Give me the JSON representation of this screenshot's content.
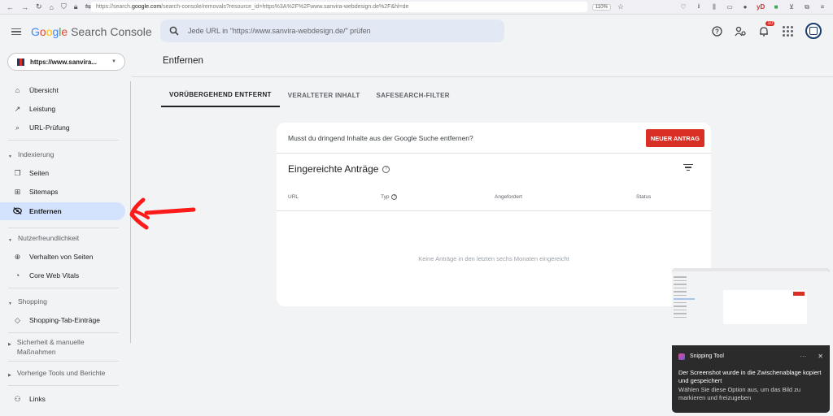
{
  "browser": {
    "url_prefix": "https://search.",
    "url_domain": "google.com",
    "url_rest": "/search-console/removals?resource_id=https%3A%2F%2Fwww.sanvira-webdesign.de%2F&hl=de",
    "zoom": "110%",
    "ext_badge": "yD"
  },
  "header": {
    "logo_letters": [
      "G",
      "o",
      "o",
      "g",
      "l",
      "e"
    ],
    "product": " Search Console",
    "search_placeholder": "Jede URL in \"https://www.sanvira-webdesign.de/\" prüfen",
    "notification_count": "10"
  },
  "colors": {
    "accent": "#d93025",
    "active_nav": "#d3e3fd",
    "brand_blue": "#4285f4"
  },
  "sidebar": {
    "property": "https://www.sanvira...",
    "items": {
      "overview": "Übersicht",
      "performance": "Leistung",
      "url_inspection": "URL-Prüfung",
      "indexing_section": "Indexierung",
      "pages": "Seiten",
      "sitemaps": "Sitemaps",
      "removals": "Entfernen",
      "experience_section": "Nutzerfreundlichkeit",
      "page_experience": "Verhalten von Seiten",
      "core_web_vitals": "Core Web Vitals",
      "shopping_section": "Shopping",
      "shopping_tab": "Shopping-Tab-Einträge",
      "security_section": "Sicherheit & manuelle Maßnahmen",
      "legacy_section": "Vorherige Tools und Berichte",
      "links": "Links"
    }
  },
  "main": {
    "page_title": "Entfernen",
    "tabs": [
      {
        "label": "VORÜBERGEHEND ENTFERNT",
        "active": true
      },
      {
        "label": "VERALTETER INHALT",
        "active": false
      },
      {
        "label": "SAFESEARCH-FILTER",
        "active": false
      }
    ],
    "card": {
      "prompt": "Musst du dringend Inhalte aus der Google Suche entfernen?",
      "new_request_label": "NEUER ANTRAG",
      "heading": "Eingereichte Anträge",
      "columns": [
        "URL",
        "Typ",
        "Angefordert",
        "Status"
      ],
      "empty_message": "Keine Anträge in den letzten sechs Monaten eingereicht"
    }
  },
  "snipping_tool": {
    "app_name": "Snipping Tool",
    "message": "Der Screenshot wurde in die Zwischenablage kopiert und gespeichert",
    "hint": "Wählen Sie diese Option aus, um das Bild zu markieren und freizugeben"
  }
}
